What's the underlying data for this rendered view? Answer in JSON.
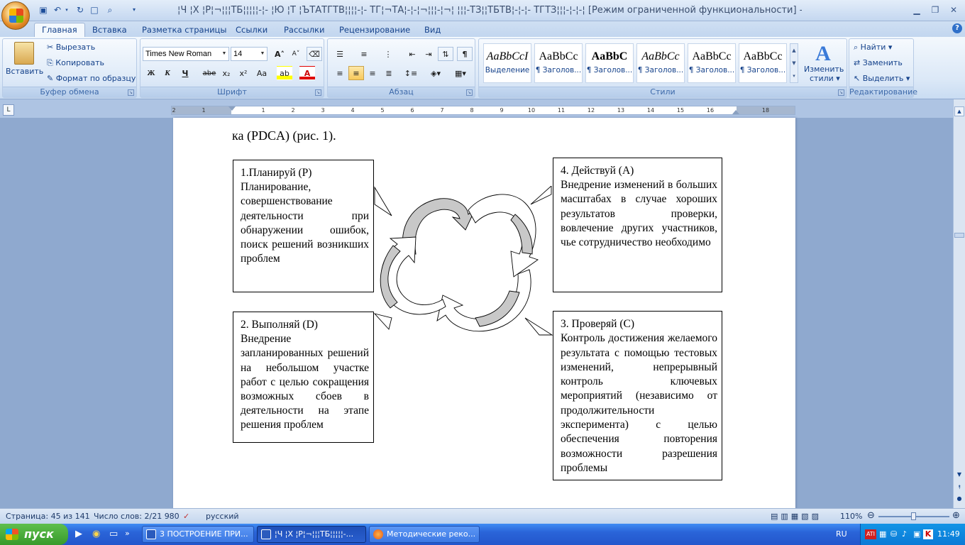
{
  "window": {
    "title": "¦Ч ¦Х ¦Р¦¬¦¦¦ТБ¦¦¦¦¦-¦-   ¦Ю ¦Т ¦ЪТАТГТВ¦¦¦¦-¦- ТГ¦¬ТА¦-¦-¦¬¦¦¦-¦¬¦ ¦¦¦-ТЗ¦¦ТБТВ¦-¦-¦- ТГТЗ¦¦¦-¦-¦-¦ [Режим ограниченной функциональности] - Microsoft Word"
  },
  "tabs": [
    "Главная",
    "Вставка",
    "Разметка страницы",
    "Ссылки",
    "Рассылки",
    "Рецензирование",
    "Вид"
  ],
  "clipboard": {
    "paste": "Вставить",
    "cut": "Вырезать",
    "copy": "Копировать",
    "format_painter": "Формат по образцу",
    "label": "Буфер обмена"
  },
  "font": {
    "name": "Times New Roman",
    "size": "14",
    "bold": "Ж",
    "italic": "К",
    "underline": "Ч",
    "strike": "abe",
    "sub": "x₂",
    "sup": "x²",
    "case": "Aa",
    "label": "Шрифт"
  },
  "paragraph": {
    "label": "Абзац",
    "marks": "¶"
  },
  "styles": {
    "label": "Стили",
    "change": "Изменить",
    "change2": "стили",
    "tiles": [
      {
        "preview": "AaBbCcI",
        "name": "Выделение"
      },
      {
        "preview": "AaBbCc",
        "name": "¶ Заголов..."
      },
      {
        "preview": "AaBbC",
        "name": "¶ Заголов..."
      },
      {
        "preview": "AaBbCc",
        "name": "¶ Заголов..."
      },
      {
        "preview": "AaBbCc",
        "name": "¶ Заголов..."
      },
      {
        "preview": "AaBbCc",
        "name": "¶ Заголов..."
      }
    ]
  },
  "editing": {
    "find": "Найти",
    "replace": "Заменить",
    "select": "Выделить",
    "label": "Редактирование"
  },
  "ruler": {
    "marks": [
      "2",
      "1",
      "1",
      "2",
      "3",
      "4",
      "5",
      "6",
      "7",
      "8",
      "9",
      "10",
      "11",
      "12",
      "13",
      "14",
      "15",
      "16",
      "18"
    ]
  },
  "document": {
    "top_line": "ка (PDCA) (рис. 1).",
    "boxes": {
      "plan": {
        "title": "1.Планируй (Р)",
        "text": "Планирование, совершенствование деятельности при обнаружении ошибок, поиск решений возникших проблем"
      },
      "act": {
        "title": "4. Действуй (А)",
        "text": "Внедрение изменений в больших масштабах в случае хороших результатов проверки, вовлечение других участников, чье сотрудничество необходимо"
      },
      "do": {
        "title": "2. Выполняй (D)",
        "text": "Внедрение запланированных решений на небольшом участке работ с целью сокращения возможных сбоев в деятельности на этапе решения проблем"
      },
      "check": {
        "title": "3. Проверяй (С)",
        "text": "Контроль достижения желаемого результата с помощью тестовых изменений, непрерывный контроль ключевых мероприятий (независимо от продолжительности эксперимента) с целью обеспечения повторения возможности разрешения проблемы"
      }
    }
  },
  "status": {
    "page": "Страница: 45 из 141",
    "words": "Число слов: 2/21 980",
    "language": "русский",
    "zoom": "110%"
  },
  "taskbar": {
    "start": "пуск",
    "tasks": [
      "3 ПОСТРОЕНИЕ ПРИ...",
      "¦Ч ¦Х ¦Р¦¬¦¦¦ТБ¦¦¦¦¦-...",
      "Методические реко..."
    ],
    "lang": "RU",
    "clock": "11:49"
  },
  "colors": {
    "ribbon_text": "#15428b",
    "arrow_fill": "#c8c8c8",
    "taskbar": "#2a64d8",
    "start": "#379a2b"
  }
}
